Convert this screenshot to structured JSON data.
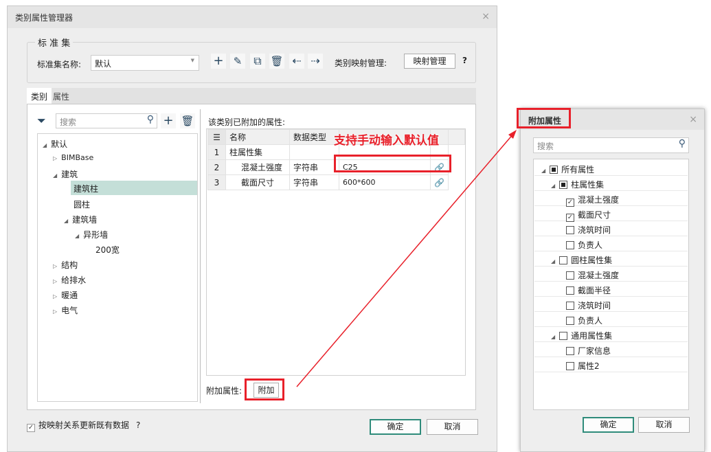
{
  "main": {
    "title": "类别属性管理器",
    "close": "×",
    "group_title": "标 准 集",
    "set_name_label": "标准集名称:",
    "set_name_value": "默认",
    "mapping_label": "类别映射管理:",
    "mapping_button": "映射管理",
    "help": "?",
    "tabs": [
      "类别",
      "属性"
    ],
    "search_placeholder": "搜索",
    "tree": [
      "默认",
      "BIMBase",
      "建筑",
      "建筑柱",
      "圆柱",
      "建筑墙",
      "异形墙",
      "200宽",
      "结构",
      "给排水",
      "暖通",
      "电气"
    ],
    "attached_label": "该类别已附加的属性:",
    "table": {
      "headers": [
        "名称",
        "数据类型",
        ""
      ],
      "rows": [
        {
          "idx": "1",
          "name": "柱属性集",
          "type": "",
          "value": ""
        },
        {
          "idx": "2",
          "name": "混凝土强度",
          "type": "字符串",
          "value": "C25"
        },
        {
          "idx": "3",
          "name": "截面尺寸",
          "type": "字符串",
          "value": "600*600"
        }
      ]
    },
    "attach_label": "附加属性:",
    "attach_button": "附加",
    "update_checkbox": "按映射关系更新既有数据",
    "update_checked": true,
    "ok": "确定",
    "cancel": "取消"
  },
  "annotation": "支持手动输入默认值",
  "popup": {
    "title": "附加属性",
    "close": "×",
    "search_placeholder": "搜索",
    "items": [
      {
        "label": "所有属性",
        "state": "partial"
      },
      {
        "label": "柱属性集",
        "state": "partial"
      },
      {
        "label": "混凝土强度",
        "state": "checked"
      },
      {
        "label": "截面尺寸",
        "state": "checked"
      },
      {
        "label": "浇筑时间",
        "state": "unchecked"
      },
      {
        "label": "负责人",
        "state": "unchecked"
      },
      {
        "label": "圆柱属性集",
        "state": "unchecked"
      },
      {
        "label": "混凝土强度",
        "state": "unchecked"
      },
      {
        "label": "截面半径",
        "state": "unchecked"
      },
      {
        "label": "浇筑时间",
        "state": "unchecked"
      },
      {
        "label": "负责人",
        "state": "unchecked"
      },
      {
        "label": "通用属性集",
        "state": "unchecked"
      },
      {
        "label": "厂家信息",
        "state": "unchecked"
      },
      {
        "label": "属性2",
        "state": "unchecked"
      }
    ],
    "ok": "确定",
    "cancel": "取消"
  },
  "colors": {
    "accent": "#2e8b7a",
    "highlight": "#c4dfd8",
    "annotation": "#e8202a"
  }
}
